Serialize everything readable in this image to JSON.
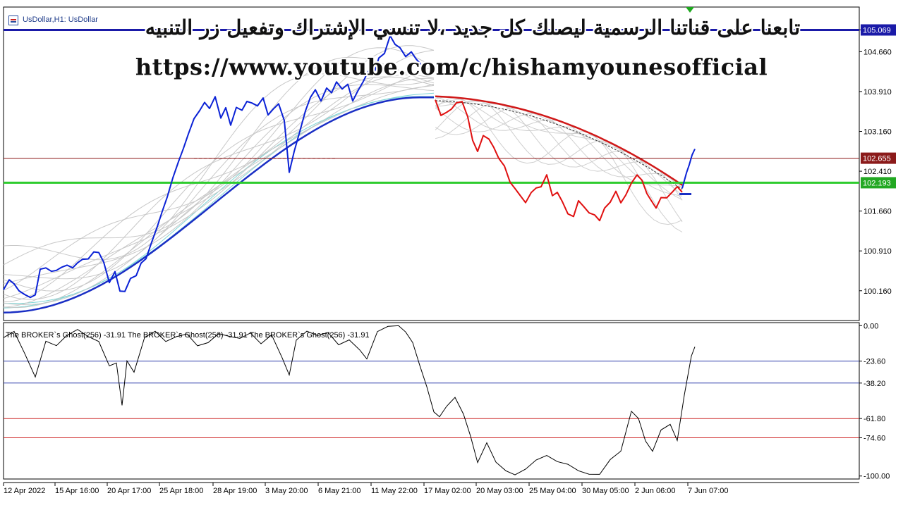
{
  "window": {
    "symbol_label": "UsDollar,H1: UsDollar"
  },
  "overlay": {
    "arabic_text": "تابعنا على قناتنا الرسمية ليصلك كل جديد ،لا تنسي الإشتراك وتفعيل زر التنبيه",
    "url": "https://www.youtube.com/c/hishamyounesofficial"
  },
  "colors": {
    "up_series": "#0b22d6",
    "down_series": "#e01010",
    "resistance_line": "#8b1a1a",
    "support_line": "#2ecc2e",
    "top_line": "#1a1aa8",
    "grid_upper_band": "#2b3aa8",
    "grid_lower_band": "#cc2020"
  },
  "chart_data": [
    {
      "type": "line",
      "title": "",
      "series": [
        {
          "color": "#0b22d6",
          "x": [
            0,
            8,
            15,
            22,
            30,
            38,
            45,
            52,
            60,
            68,
            75,
            82,
            90,
            98,
            105,
            112,
            120,
            128,
            135,
            142,
            150,
            158,
            165,
            172,
            180,
            188,
            195,
            202,
            210,
            218,
            225,
            232,
            240,
            248,
            255,
            262,
            270,
            278,
            285,
            292,
            300,
            308,
            315,
            322,
            330,
            338,
            345,
            352,
            360,
            368,
            375,
            382,
            390,
            398,
            405,
            412,
            420,
            428,
            435,
            442,
            450,
            458,
            465,
            472,
            480,
            488,
            495,
            502,
            510,
            518,
            525,
            532,
            540,
            548,
            555,
            562,
            570,
            578,
            585,
            592,
            600
          ],
          "y": [
            100.18,
            100.35,
            100.26,
            100.12,
            100.05,
            100.0,
            100.06,
            100.56,
            100.6,
            100.55,
            100.58,
            100.64,
            100.68,
            100.62,
            100.7,
            100.75,
            100.74,
            100.86,
            100.84,
            100.66,
            100.28,
            100.5,
            100.15,
            100.16,
            100.42,
            100.48,
            100.72,
            100.8,
            101.1,
            101.38,
            101.65,
            101.9,
            102.25,
            102.55,
            102.8,
            103.08,
            103.38,
            103.55,
            103.72,
            103.62,
            103.85,
            103.45,
            103.64,
            103.3,
            103.62,
            103.55,
            103.7,
            103.66,
            103.6,
            103.75,
            103.44,
            103.56,
            103.68,
            103.38,
            102.42,
            102.82,
            103.2,
            103.58,
            103.82,
            103.95,
            103.72,
            103.95,
            103.85,
            104.05,
            103.92,
            104.02,
            103.72,
            103.92,
            104.12,
            104.35,
            104.28,
            104.58,
            104.66,
            104.98,
            104.8,
            104.72,
            104.54,
            104.62,
            104.48,
            104.38,
            104.25
          ]
        },
        {
          "color": "#e01010",
          "x": [
            612,
            620,
            628,
            635,
            642,
            650,
            658,
            665,
            672,
            680,
            688,
            695,
            702,
            710,
            718,
            725,
            732,
            740,
            748,
            755,
            762,
            770,
            778,
            785,
            792,
            800,
            808,
            815,
            822,
            830,
            838,
            845,
            852,
            860,
            868,
            875,
            882,
            890,
            898,
            905,
            912,
            918,
            925,
            932,
            940,
            948,
            955,
            962
          ],
          "y": [
            103.72,
            103.42,
            103.48,
            103.55,
            103.68,
            103.72,
            103.45,
            103.02,
            102.82,
            103.12,
            103.05,
            102.88,
            102.66,
            102.5,
            102.18,
            102.05,
            101.92,
            101.78,
            101.98,
            102.08,
            102.12,
            102.36,
            101.98,
            102.05,
            101.88,
            101.64,
            101.58,
            101.86,
            101.74,
            101.6,
            101.55,
            101.44,
            101.68,
            101.8,
            102.02,
            101.82,
            101.98,
            102.22,
            102.38,
            102.28,
            102.02,
            101.88,
            101.72,
            101.9,
            101.88,
            101.98,
            102.08,
            101.98
          ]
        },
        {
          "color": "#0b22d6",
          "x": [
            962,
            968,
            972,
            976,
            980
          ],
          "y": [
            102.05,
            102.35,
            102.52,
            102.72,
            102.85
          ]
        }
      ],
      "ylim": [
        99.6,
        105.5
      ],
      "y_ticks": [
        "105.069",
        "104.660",
        "103.910",
        "103.160",
        "102.410",
        "101.660",
        "100.910",
        "100.160"
      ],
      "price_labels": [
        {
          "text": "105.069",
          "value": 105.069,
          "color": "#1a1aa8"
        },
        {
          "text": "102.655",
          "value": 102.655,
          "color": "#8b1a1a"
        },
        {
          "text": "102.193",
          "value": 102.193,
          "color": "#22a822"
        }
      ],
      "horizontal_lines": [
        {
          "value": 105.069,
          "color": "#1a1aa8"
        },
        {
          "value": 102.655,
          "color": "#8b1a1a"
        },
        {
          "value": 102.193,
          "color": "#2ecc2e"
        }
      ],
      "grid": false
    },
    {
      "type": "line",
      "title": "",
      "indicator_label": "The BROKER`s Ghost(256) -31.91 The BROKER`s Ghost(256) -31.91 The BROKER`s Ghost(256) -31.91",
      "series": [
        {
          "color": "#000000",
          "x": [
            0,
            15,
            30,
            45,
            60,
            75,
            90,
            105,
            120,
            135,
            150,
            160,
            168,
            175,
            185,
            200,
            215,
            230,
            245,
            260,
            275,
            290,
            305,
            320,
            335,
            350,
            365,
            380,
            395,
            405,
            415,
            430,
            445,
            460,
            475,
            490,
            505,
            515,
            530,
            545,
            560,
            570,
            580,
            590,
            600,
            610,
            618,
            628,
            640,
            652,
            662,
            672,
            685,
            698,
            712,
            725,
            740,
            755,
            770,
            785,
            800,
            815,
            830,
            845,
            860,
            875,
            890,
            900,
            910,
            920,
            932,
            945,
            955,
            965,
            975,
            980
          ],
          "y": [
            -8,
            -5,
            -20,
            -35,
            -10,
            -12,
            -5,
            -2,
            -8,
            -12,
            -28,
            -25,
            -52,
            -22,
            -30,
            -8,
            -5,
            -12,
            -8,
            -5,
            -12,
            -10,
            -5,
            -8,
            -10,
            -6,
            -12,
            -5,
            -20,
            -32,
            -10,
            -5,
            -8,
            -5,
            -12,
            -8,
            -15,
            -22,
            -5,
            -2,
            -1,
            -4,
            -10,
            -25,
            -40,
            -58,
            -62,
            -55,
            -48,
            -58,
            -72,
            -90,
            -78,
            -92,
            -98,
            -100,
            -95,
            -88,
            -85,
            -90,
            -93,
            -98,
            -100,
            -99,
            -88,
            -82,
            -56,
            -62,
            -78,
            -85,
            -70,
            -65,
            -75,
            -45,
            -20,
            -15
          ]
        }
      ],
      "ylim": [
        -102,
        2
      ],
      "y_ticks": [
        "0.00",
        "-23.60",
        "-38.20",
        "-61.80",
        "-74.60",
        "-100.00"
      ],
      "level_lines": [
        {
          "value": -23.6,
          "color": "#2b3aa8"
        },
        {
          "value": -38.2,
          "color": "#2b3aa8"
        },
        {
          "value": -61.8,
          "color": "#cc2020"
        },
        {
          "value": -74.6,
          "color": "#cc2020"
        }
      ],
      "x_tick_labels": [
        "12 Apr 2022",
        "15 Apr 16:00",
        "20 Apr 17:00",
        "25 Apr 18:00",
        "28 Apr 19:00",
        "3 May 20:00",
        "6 May 21:00",
        "11 May 22:00",
        "17 May 02:00",
        "20 May 03:00",
        "25 May 04:00",
        "30 May 05:00",
        "2 Jun 06:00",
        "7 Jun 07:00"
      ]
    }
  ]
}
